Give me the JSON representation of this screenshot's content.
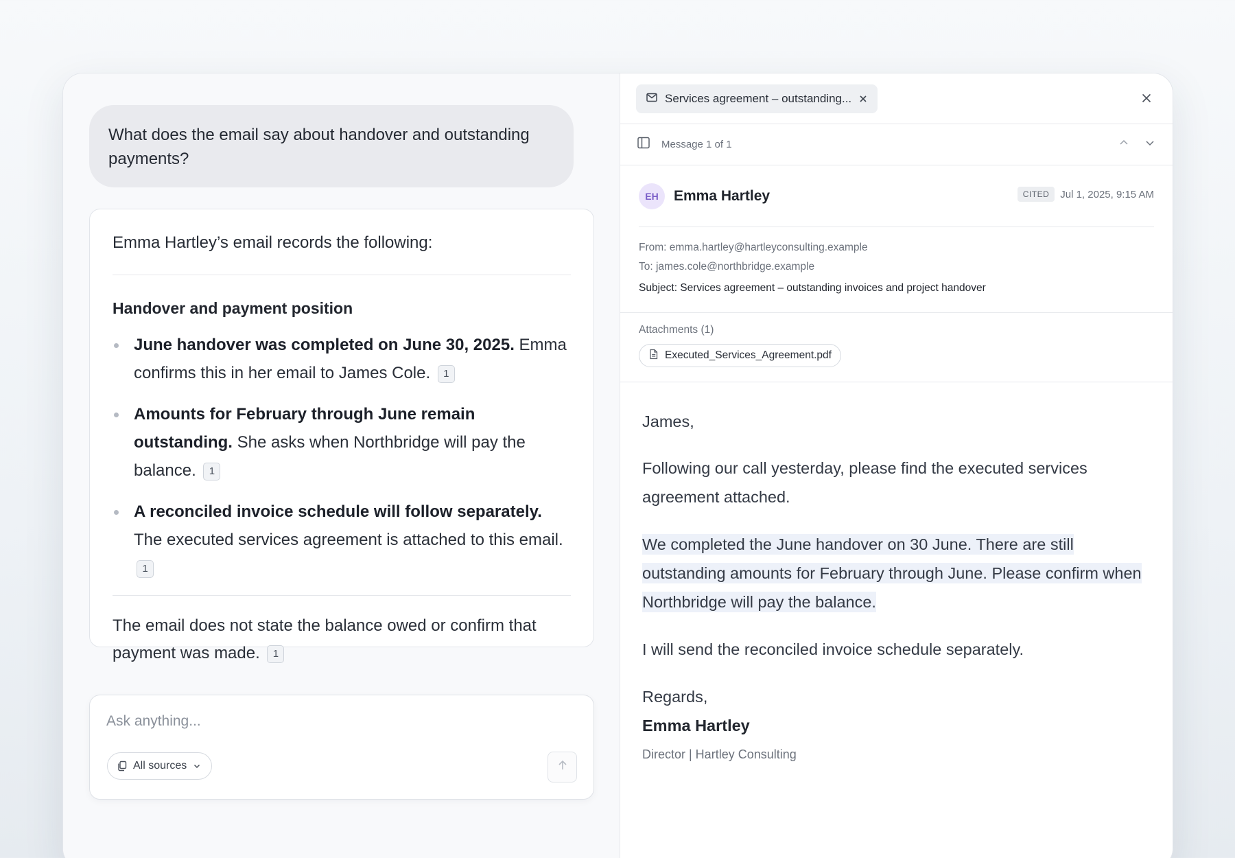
{
  "chat": {
    "user_question": "What does the email say about handover and outstanding payments?",
    "answer": {
      "intro": "Emma Hartley’s email records the following:",
      "heading": "Handover and payment position",
      "bullets": [
        {
          "bold": "June handover was completed on June 30, 2025.",
          "text": " Emma confirms this in her email to James Cole.",
          "cite": "1"
        },
        {
          "bold": "Amounts for February through June remain outstanding.",
          "text": " She asks when Northbridge will pay the balance.",
          "cite": "1"
        },
        {
          "bold": "A reconciled invoice schedule will follow separately.",
          "text": " The executed services agreement is attached to this email.",
          "cite": "1"
        }
      ],
      "footer": "The email does not state the balance owed or confirm that payment was made.",
      "footer_cite": "1"
    },
    "composer": {
      "placeholder": "Ask anything...",
      "sources_label": "All sources"
    }
  },
  "viewer": {
    "tab_title": "Services agreement – outstanding...",
    "message_count": "Message 1 of 1",
    "sender": {
      "initials": "EH",
      "name": "Emma Hartley",
      "badge": "CITED",
      "timestamp": "Jul 1, 2025, 9:15 AM"
    },
    "headers": {
      "from": "From: emma.hartley@hartleyconsulting.example",
      "to": "To: james.cole@northbridge.example",
      "subject": "Subject: Services agreement – outstanding invoices and project handover"
    },
    "attachments": {
      "label": "Attachments (1)",
      "files": [
        "Executed_Services_Agreement.pdf"
      ]
    },
    "body": {
      "greeting": "James,",
      "para1": "Following our call yesterday, please find the executed services agreement attached.",
      "highlighted": "We completed the June handover on 30 June. There are still outstanding amounts for February through June. Please confirm when Northbridge will pay the balance.",
      "para3": "I will send the reconciled invoice schedule separately.",
      "regards": "Regards,",
      "signature_name": "Emma Hartley",
      "signature_title": "Director | Hartley Consulting"
    }
  },
  "colors": {
    "highlight": "#edf1f9",
    "avatar_bg": "#ebe4fb",
    "avatar_text": "#7a5ec8"
  }
}
